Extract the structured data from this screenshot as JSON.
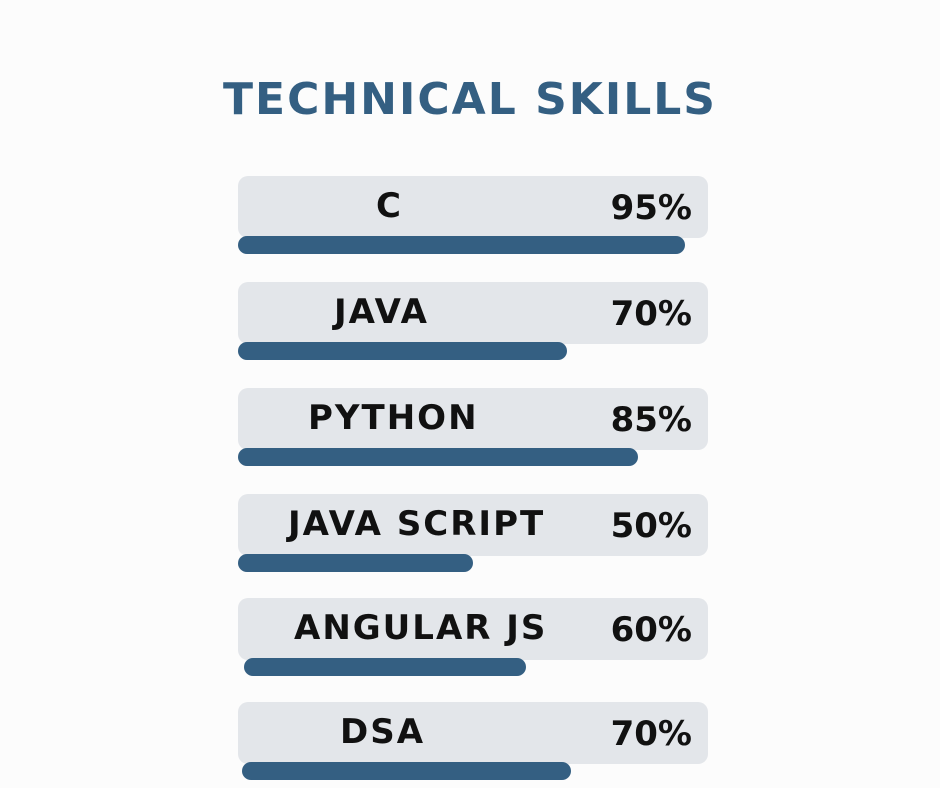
{
  "colors": {
    "background": "#fcfcfc",
    "accent": "#345f82",
    "panel": "#e3e6ea",
    "text": "#111111"
  },
  "page": {
    "title": "TECHNICAL SKILLS"
  },
  "skills": [
    {
      "name": "C",
      "percent_label": "95%",
      "level": 0.95
    },
    {
      "name": "JAVA",
      "percent_label": "70%",
      "level": 0.7
    },
    {
      "name": "PYTHON",
      "percent_label": "85%",
      "level": 0.85
    },
    {
      "name": "JAVA SCRIPT",
      "percent_label": "50%",
      "level": 0.5
    },
    {
      "name": "ANGULAR JS",
      "percent_label": "60%",
      "level": 0.6
    },
    {
      "name": "DSA",
      "percent_label": "70%",
      "level": 0.7
    }
  ]
}
